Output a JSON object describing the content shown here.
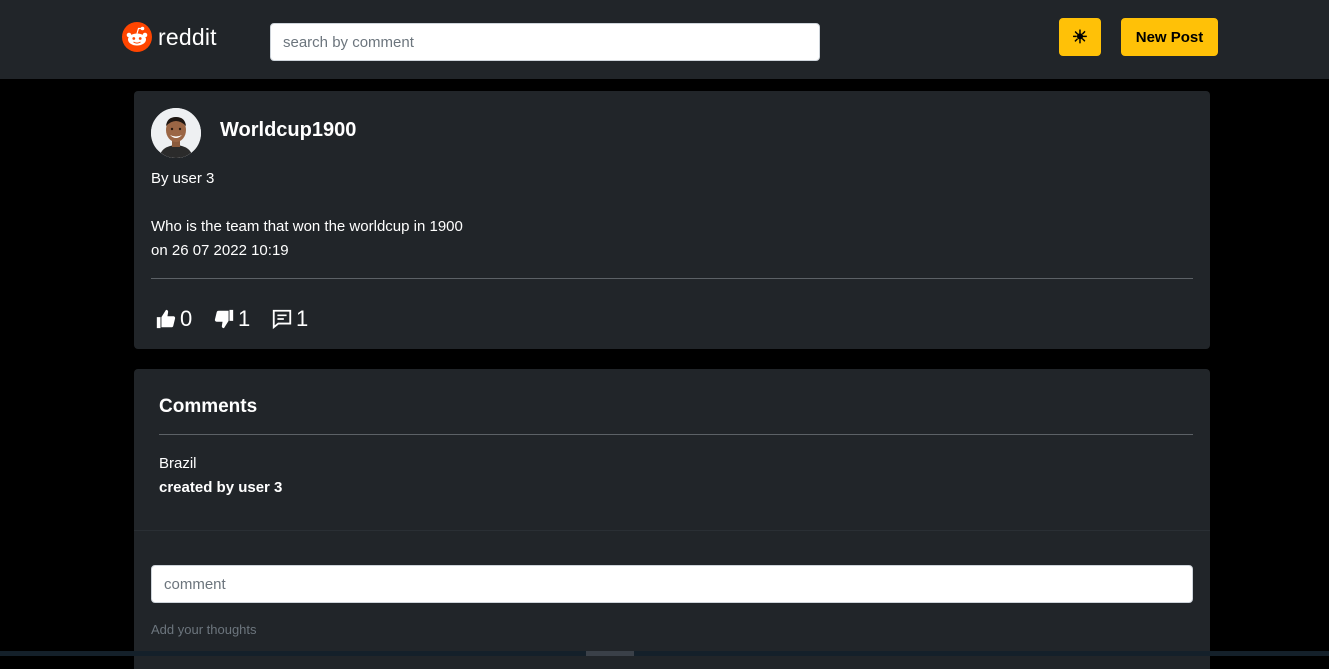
{
  "navbar": {
    "brand_text": "reddit",
    "search_placeholder": "search by comment",
    "theme_toggle_glyph": "☀",
    "new_post_label": "New Post"
  },
  "post": {
    "title": "Worldcup1900",
    "author": "By user 3",
    "body": "Who is the team that won the worldcup in 1900",
    "date": "on 26 07 2022 10:19",
    "likes": "0",
    "dislikes": "1",
    "comments_count": "1",
    "icons": {
      "like": "thumbs-up-icon",
      "dislike": "thumbs-down-icon",
      "comment": "comment-icon"
    }
  },
  "comments": {
    "heading": "Comments",
    "items": [
      {
        "text": "Brazil",
        "created_by": "created by user 3"
      }
    ],
    "input_placeholder": "comment",
    "help_text": "Add your thoughts"
  },
  "colors": {
    "navbar_bg": "#212529",
    "page_bg": "#000000",
    "accent": "#ffc107",
    "brand": "#ff4500"
  }
}
